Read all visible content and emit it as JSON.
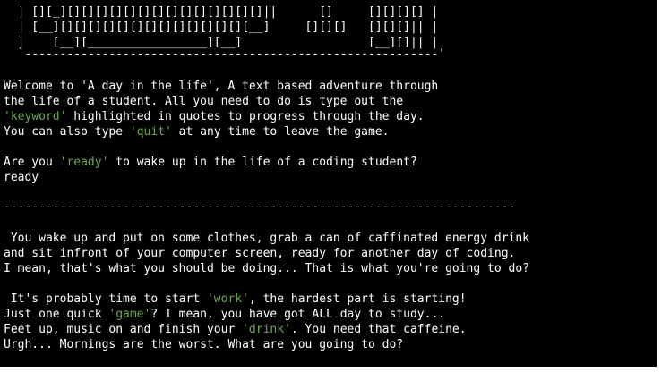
{
  "terminal": {
    "background": "#000000",
    "text_color": "#ffffff",
    "keyword_color": "#6aa84f",
    "banner": [
      "  | [][_][][][][][][][][][][][][][][]||      []     [][][][] |",
      "  | [__][][][][][][][][][][][][][][__]     [][][]   [][][]|| |",
      "  |    [__][_________________][__]                  [__][]|| |",
      "  `-----------------------------------------------------------'"
    ],
    "intro": {
      "line1": "Welcome to 'A day in the life', A text based adventure through",
      "line2": "the life of a student. All you need to do is type out the",
      "line3_keyword": "'keyword'",
      "line3_rest": " highlighted in quotes to progress through the day.",
      "line4_pre": "You can also type ",
      "line4_keyword": "'quit'",
      "line4_post": " at any time to leave the game."
    },
    "prompt": {
      "pre": "Are you ",
      "keyword": "'ready'",
      "post": " to wake up in the life of a coding student?",
      "user_input": "ready"
    },
    "divider": "-------------------------------------------------------------------------",
    "story": {
      "line1": " You wake up and put on some clothes, grab a can of caffinated energy drink",
      "line2": "and sit infront of your computer screen, ready for another day of coding.",
      "line3": "I mean, that's what you should be doing... That is what you're going to do?",
      "line4_pre": " It's probably time to start ",
      "line4_keyword": "'work'",
      "line4_post": ", the hardest part is starting!",
      "line5_pre": "Just one quick ",
      "line5_keyword": "'game'",
      "line5_post": "? I mean, you have got ALL day to study...",
      "line6_pre": "Feet up, music on and finish your ",
      "line6_keyword": "'drink'",
      "line6_post": ". You need that caffeine.",
      "line7": "Urgh... Mornings are the worst. What are you going to do?"
    }
  }
}
